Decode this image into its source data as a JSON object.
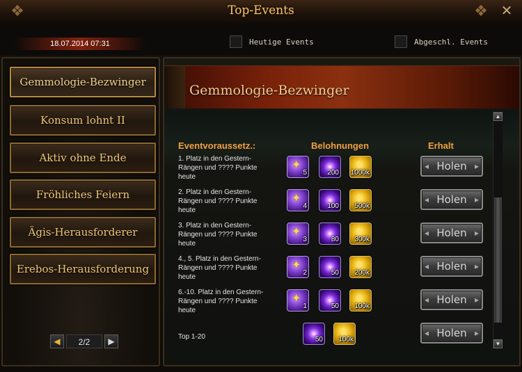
{
  "window": {
    "title": "Top-Events",
    "close_icon": "close-icon"
  },
  "header": {
    "datetime": "18.07.2014 07:31",
    "filters": [
      {
        "label": "Heutige Events",
        "checked": false
      },
      {
        "label": "Abgeschl. Events",
        "checked": false
      }
    ]
  },
  "sidebar": {
    "items": [
      {
        "label": "Gemmologie-Bezwinger",
        "active": true
      },
      {
        "label": "Konsum lohnt II",
        "active": false
      },
      {
        "label": "Aktiv ohne Ende",
        "active": false
      },
      {
        "label": "Fröhliches Feiern",
        "active": false
      },
      {
        "label": "Ägis-Herausforderer",
        "active": false
      },
      {
        "label": "Erebos-Herausforderung",
        "active": false
      }
    ],
    "pager": {
      "page": "2/2"
    }
  },
  "event": {
    "title": "Gemmologie-Bezwinger",
    "columns": {
      "requirement": "Eventvoraussetz.:",
      "rewards": "Belohnungen",
      "claim": "Erhalt"
    },
    "rows": [
      {
        "requirement": "1. Platz in den Gestern-Rängen und ???? Punkte heute",
        "rewards": [
          {
            "type": "gem",
            "qty": "5"
          },
          {
            "type": "orb",
            "qty": "200"
          },
          {
            "type": "coin",
            "qty": "1000k"
          }
        ],
        "button": "Holen"
      },
      {
        "requirement": "2. Platz in den Gestern-Rängen und ???? Punkte heute",
        "rewards": [
          {
            "type": "gem",
            "qty": "4"
          },
          {
            "type": "orb",
            "qty": "100"
          },
          {
            "type": "coin",
            "qty": "500k"
          }
        ],
        "button": "Holen"
      },
      {
        "requirement": "3. Platz in den Gestern-Rängen und ???? Punkte heute",
        "rewards": [
          {
            "type": "gem",
            "qty": "3"
          },
          {
            "type": "orb",
            "qty": "80"
          },
          {
            "type": "coin",
            "qty": "300k"
          }
        ],
        "button": "Holen"
      },
      {
        "requirement": "4., 5. Platz in den Gestern-Rängen und ???? Punkte heute",
        "rewards": [
          {
            "type": "gem",
            "qty": "2"
          },
          {
            "type": "orb",
            "qty": "50"
          },
          {
            "type": "coin",
            "qty": "200k"
          }
        ],
        "button": "Holen"
      },
      {
        "requirement": "6.-10. Platz in den Gestern-Rängen und ???? Punkte heute",
        "rewards": [
          {
            "type": "gem",
            "qty": "1"
          },
          {
            "type": "orb",
            "qty": "50"
          },
          {
            "type": "coin",
            "qty": "100k"
          }
        ],
        "button": "Holen"
      },
      {
        "requirement": "Top 1-20",
        "rewards": [
          {
            "type": "orb",
            "qty": "50"
          },
          {
            "type": "coin",
            "qty": "100k"
          }
        ],
        "button": "Holen"
      }
    ]
  }
}
